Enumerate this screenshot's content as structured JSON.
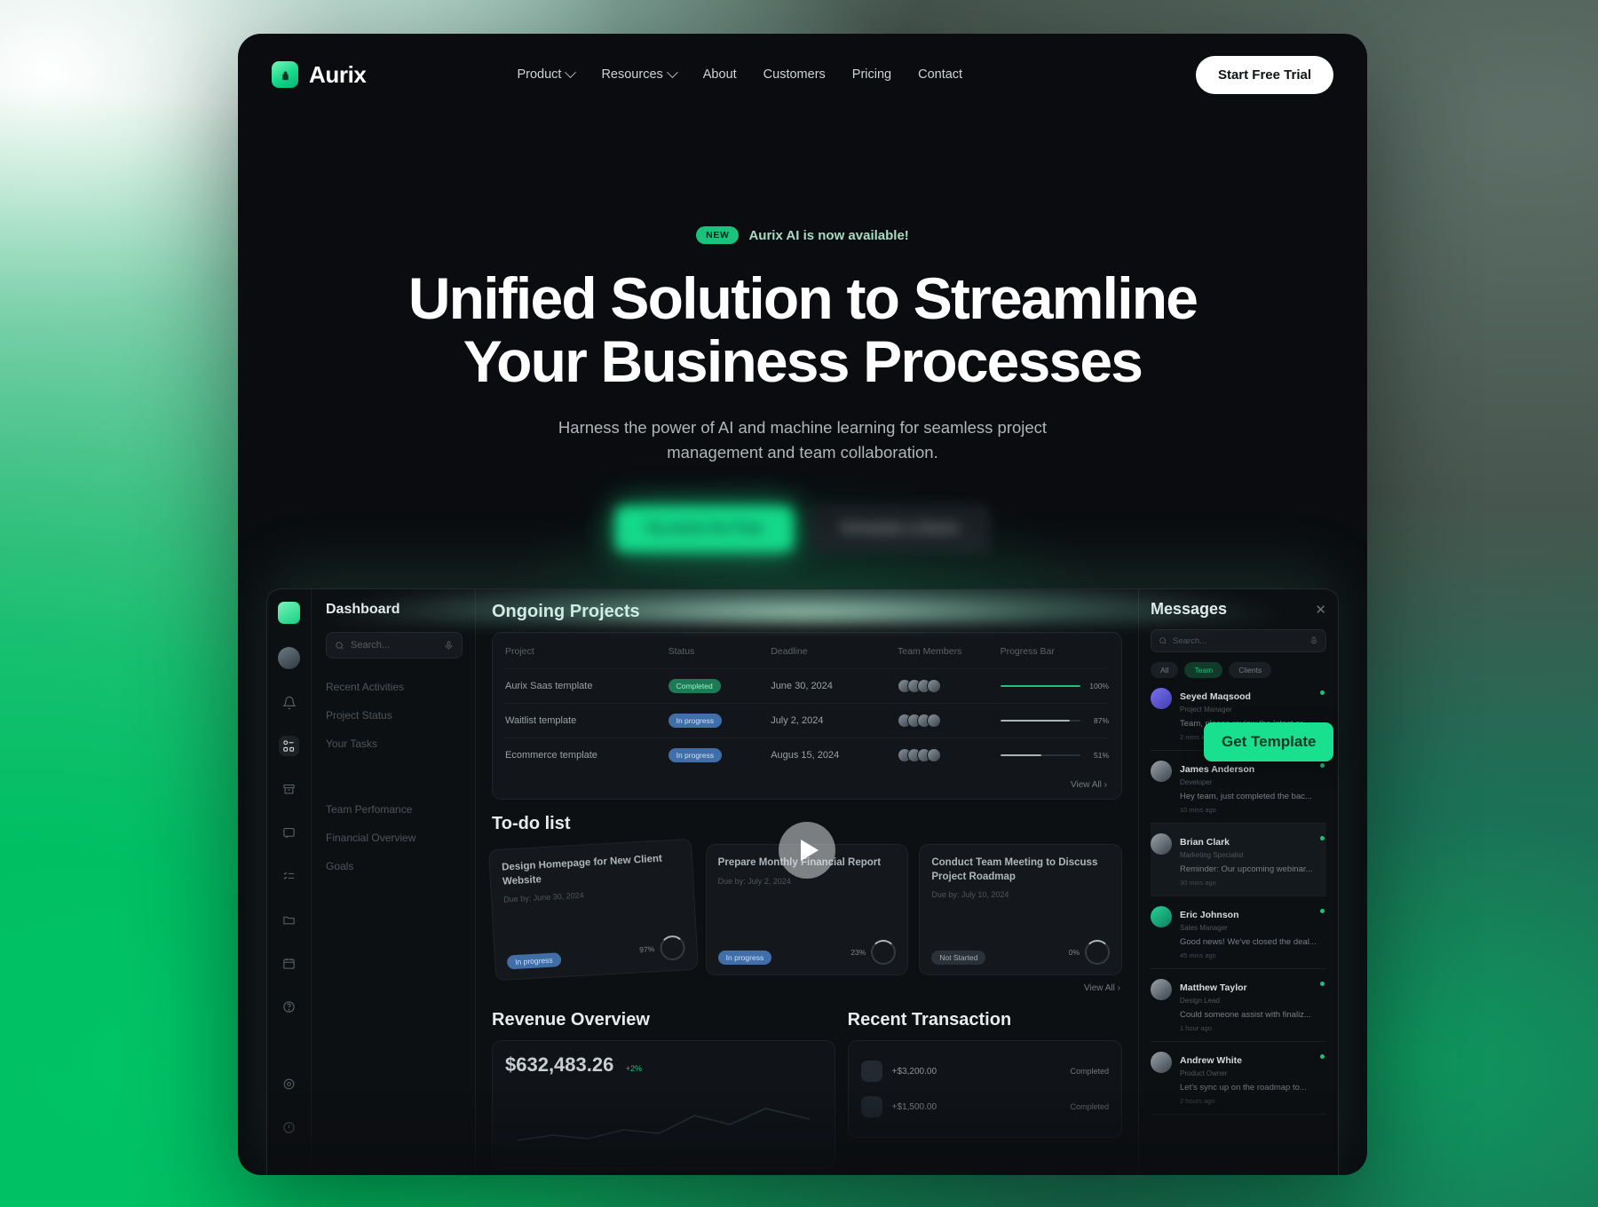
{
  "nav": {
    "brand": "Aurix",
    "links": [
      {
        "label": "Product",
        "has_chevron": true
      },
      {
        "label": "Resources",
        "has_chevron": true
      },
      {
        "label": "About",
        "has_chevron": false
      },
      {
        "label": "Customers",
        "has_chevron": false
      },
      {
        "label": "Pricing",
        "has_chevron": false
      },
      {
        "label": "Contact",
        "has_chevron": false
      }
    ],
    "cta": "Start Free Trial"
  },
  "hero": {
    "badge": "NEW",
    "announcement": "Aurix AI is now available!",
    "headline_line1": "Unified Solution to Streamline",
    "headline_line2": "Your Business Processes",
    "subhead": "Harness the power of AI and machine learning for seamless project management and team collaboration.",
    "primary_cta": "Try Aurix for Free",
    "secondary_cta": "Schedule a Demo"
  },
  "colors": {
    "accent_green": "#19c37d",
    "bright_green": "#14d98a",
    "page_green": "#00bf63",
    "dark_bg": "#0a0c0f"
  },
  "app": {
    "sidebar": {
      "title": "Dashboard",
      "search_placeholder": "Search...",
      "group1": [
        "Recent Activities",
        "Project Status",
        "Your Tasks"
      ],
      "group2": [
        "Team Perfomance",
        "Financial Overview",
        "Goals"
      ]
    },
    "projects": {
      "title": "Ongoing Projects",
      "columns": [
        "Project",
        "Status",
        "Deadline",
        "Team Members",
        "Progress Bar"
      ],
      "rows": [
        {
          "project": "Aurix Saas template",
          "status": "Completed",
          "status_kind": "done",
          "deadline": "June 30, 2024",
          "members": 4,
          "progress": 100,
          "pct": "100%"
        },
        {
          "project": "Waitlist template",
          "status": "In progress",
          "status_kind": "prog",
          "deadline": "July 2, 2024",
          "members": 4,
          "progress": 87,
          "pct": "87%"
        },
        {
          "project": "Ecommerce template",
          "status": "In progress",
          "status_kind": "prog",
          "deadline": "Augus 15, 2024",
          "members": 4,
          "progress": 51,
          "pct": "51%"
        }
      ],
      "view_all": "View All"
    },
    "todo": {
      "title": "To-do list",
      "view_all": "View All",
      "cards": [
        {
          "title": "Design Homepage for New Client Website",
          "due": "Due by: June 30, 2024",
          "status": "In progress",
          "status_kind": "prog",
          "pct": "97%"
        },
        {
          "title": "Prepare Monthly Financial Report",
          "due": "Due by: July 2, 2024",
          "status": "In progress",
          "status_kind": "prog",
          "pct": "23%"
        },
        {
          "title": "Conduct Team Meeting to Discuss Project Roadmap",
          "due": "Due by: July 10, 2024",
          "status": "Not Started",
          "status_kind": "ns",
          "pct": "0%"
        }
      ]
    },
    "revenue": {
      "title": "Revenue Overview",
      "amount": "$632,483.26",
      "delta": "+2%"
    },
    "transactions": {
      "title": "Recent  Transaction",
      "rows": [
        {
          "amount": "+$3,200.00",
          "status": "Completed"
        },
        {
          "amount": "+$1,500.00",
          "status": "Completed"
        }
      ]
    },
    "messages": {
      "title": "Messages",
      "search_placeholder": "Search...",
      "chips": [
        "All",
        "Team",
        "Clients"
      ],
      "active_chip": "Team",
      "items": [
        {
          "name": "Seyed Maqsood",
          "role": "Project Manager",
          "preview": "Team, please review the latest pr...",
          "time": "2 mins ago",
          "online": true,
          "avatar": "p"
        },
        {
          "name": "James Anderson",
          "role": "Developer",
          "preview": "Hey team, just completed the bac...",
          "time": "10 mins ago",
          "online": true,
          "avatar": ""
        },
        {
          "name": "Brian Clark",
          "role": "Marketing Specialist",
          "preview": "Reminder: Our upcoming webinar...",
          "time": "30 mins ago",
          "online": true,
          "avatar": ""
        },
        {
          "name": "Eric Johnson",
          "role": "Sales Manager",
          "preview": "Good news! We've closed the deal...",
          "time": "45 mins ago",
          "online": true,
          "avatar": "g"
        },
        {
          "name": "Matthew Taylor",
          "role": "Design Lead",
          "preview": "Could someone assist with finaliz...",
          "time": "1 hour ago",
          "online": true,
          "avatar": ""
        },
        {
          "name": "Andrew White",
          "role": "Product Owner",
          "preview": "Let's sync up on the roadmap to...",
          "time": "2 hours ago",
          "online": true,
          "avatar": ""
        }
      ]
    }
  },
  "overlay": {
    "get_template": "Get Template"
  }
}
